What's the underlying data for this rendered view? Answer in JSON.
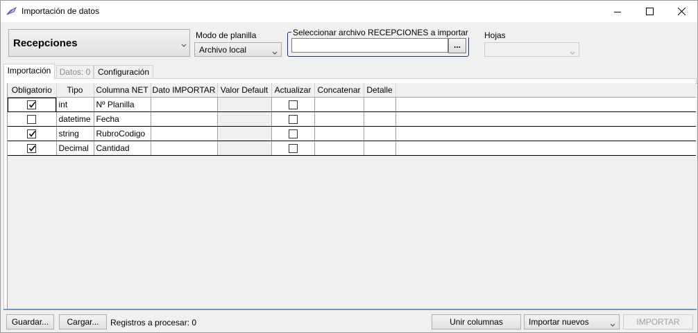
{
  "window": {
    "title": "Importación de datos",
    "icon": "pen-feather-icon",
    "controls": [
      "minimize",
      "maximize",
      "close"
    ]
  },
  "mode": {
    "selected": "Recepciones"
  },
  "planilla": {
    "label": "Modo de planilla",
    "selected": "Archivo local"
  },
  "file": {
    "legend": "Seleccionar archivo RECEPCIONES a importar",
    "value": "",
    "browse_label": "..."
  },
  "hojas": {
    "label": "Hojas",
    "selected": ""
  },
  "tabs": [
    {
      "label": "Importación",
      "active": true,
      "enabled": true
    },
    {
      "label": "Datos: 0",
      "active": false,
      "enabled": false
    },
    {
      "label": "Configuración",
      "active": false,
      "enabled": true
    }
  ],
  "grid": {
    "columns": [
      "Obligatorio",
      "Tipo",
      "Columna NET",
      "Dato IMPORTAR",
      "Valor Default",
      "Actualizar",
      "Concatenar",
      "Detalle"
    ],
    "rows": [
      {
        "obligatorio": true,
        "tipo": "int",
        "columna": "Nº Planilla",
        "dato": "",
        "valor_default": "",
        "actualizar": false,
        "concatenar": "",
        "detalle": ""
      },
      {
        "obligatorio": false,
        "tipo": "datetime",
        "columna": "Fecha",
        "dato": "",
        "valor_default": "",
        "actualizar": false,
        "concatenar": "",
        "detalle": ""
      },
      {
        "obligatorio": true,
        "tipo": "string",
        "columna": "RubroCodigo",
        "dato": "",
        "valor_default": "",
        "actualizar": false,
        "concatenar": "",
        "detalle": ""
      },
      {
        "obligatorio": true,
        "tipo": "Decimal",
        "columna": "Cantidad",
        "dato": "",
        "valor_default": "",
        "actualizar": false,
        "concatenar": "",
        "detalle": ""
      }
    ]
  },
  "footer": {
    "save_label": "Guardar...",
    "load_label": "Cargar...",
    "status": "Registros a procesar: 0",
    "merge_label": "Unir columnas",
    "import_mode": "Importar nuevos",
    "import_label": "IMPORTAR"
  },
  "colors": {
    "accent_border": "#1a2d9e",
    "grid_border": "#a0a0a0",
    "disabled_text": "#a0a0a0"
  }
}
